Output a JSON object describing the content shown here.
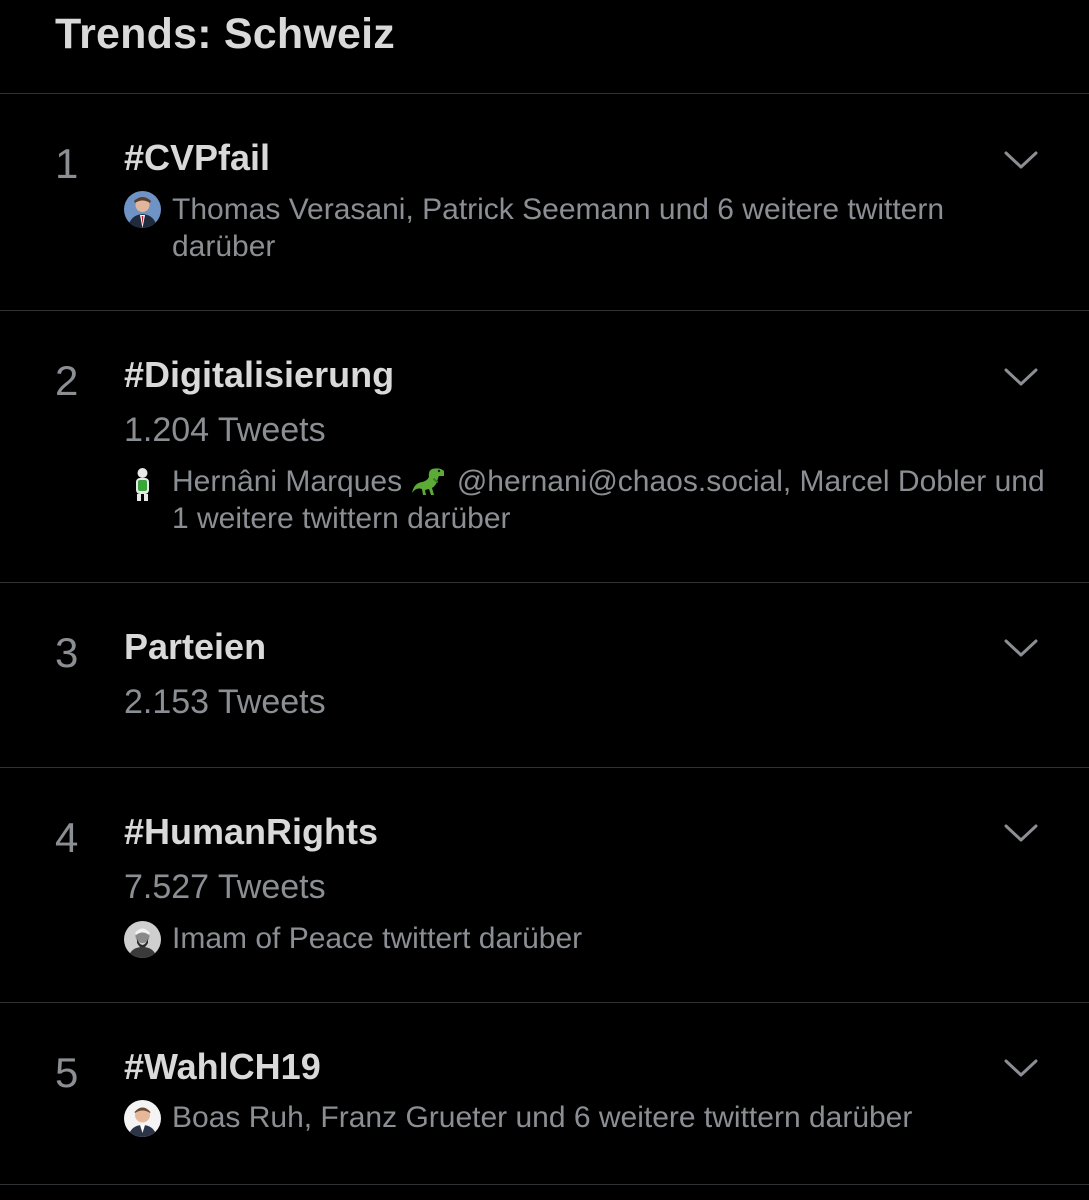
{
  "header": {
    "title": "Trends: Schweiz"
  },
  "trends": [
    {
      "rank": "1",
      "name": "#CVPfail",
      "tweets": "",
      "context": "Thomas Verasani, Patrick Seemann und 6 weitere twittern darüber"
    },
    {
      "rank": "2",
      "name": "#Digitalisierung",
      "tweets": "1.204 Tweets",
      "context_before_emoji": "Hernâni Marques",
      "context_after_emoji": "@hernani@chaos.social, Marcel Dobler und 1 weitere twittern darüber",
      "emoji_icon": "t-rex-icon"
    },
    {
      "rank": "3",
      "name": "Parteien",
      "tweets": "2.153 Tweets",
      "context": ""
    },
    {
      "rank": "4",
      "name": "#HumanRights",
      "tweets": "7.527 Tweets",
      "context": "Imam of Peace twittert darüber"
    },
    {
      "rank": "5",
      "name": "#WahlCH19",
      "tweets": "",
      "context": "Boas Ruh, Franz Grueter und 6 weitere twittern darüber"
    }
  ],
  "colors": {
    "background": "#000000",
    "primary_text": "#d9d9d9",
    "secondary_text": "#8b8f94",
    "divider": "#2f3336"
  }
}
